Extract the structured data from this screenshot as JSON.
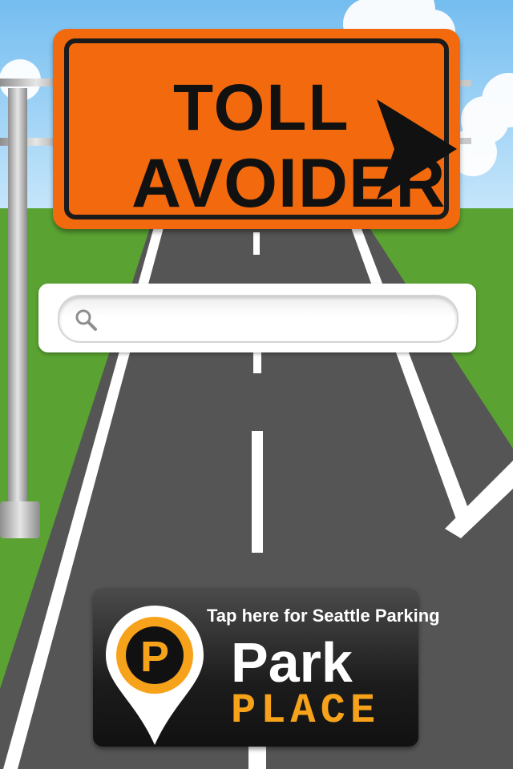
{
  "sign": {
    "line1": "TOLL",
    "line2": "AVOIDER",
    "arrow_icon": "right-arrow-icon"
  },
  "search": {
    "value": "",
    "placeholder": "",
    "icon": "search-icon"
  },
  "park_place": {
    "tagline": "Tap here for Seattle Parking",
    "brand_word1": "Park",
    "brand_word2": "PLACE",
    "logo_letter": "P",
    "logo_icon": "parking-pin-icon"
  },
  "colors": {
    "sign_orange": "#f26a0d",
    "brand_orange": "#f7a21b",
    "grass": "#5aa232",
    "sky": "#9bd0f0",
    "road": "#555555"
  }
}
